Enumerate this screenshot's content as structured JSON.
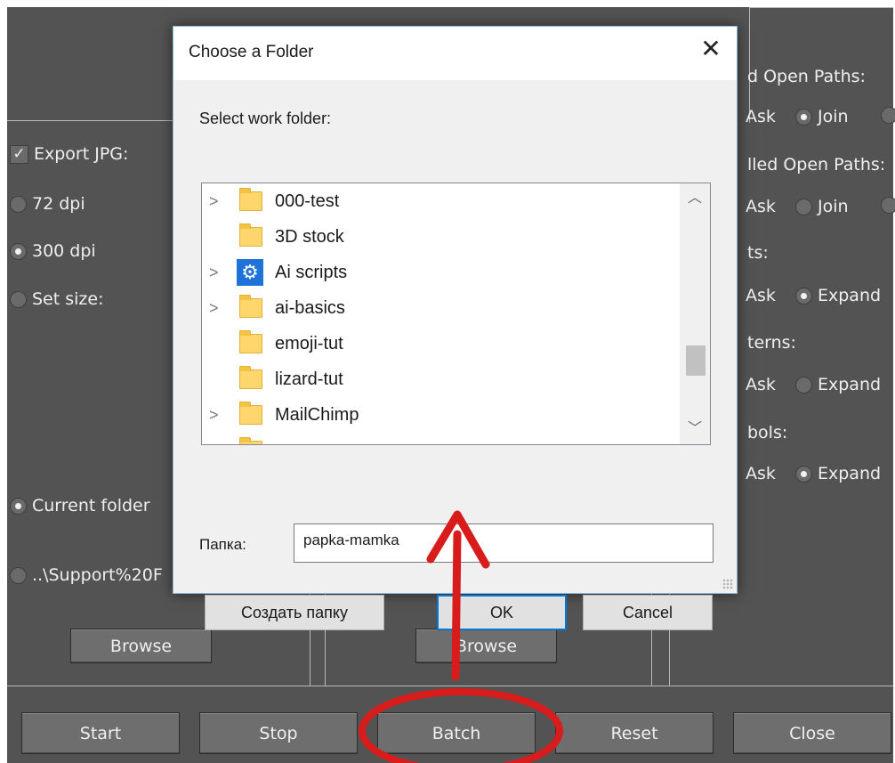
{
  "background": {
    "left": {
      "export_jpg": "Export JPG:",
      "dpi72": "72 dpi",
      "dpi300": "300 dpi",
      "set_size": "Set size:",
      "current_folder": "Current folder",
      "support_path": "..\\Support%20F",
      "browse": "Browse"
    },
    "middle": {
      "browse": "Browse"
    },
    "right": {
      "open_paths": "d Open Paths:",
      "filled_open_paths": "lled Open Paths:",
      "ts": "ts:",
      "terns": "terns:",
      "bols": "bols:",
      "ask": "Ask",
      "join": "Join",
      "expand": "Expand"
    },
    "bottom": {
      "start": "Start",
      "stop": "Stop",
      "batch": "Batch",
      "reset": "Reset",
      "close": "Close"
    }
  },
  "dialog": {
    "title": "Choose a Folder",
    "close_glyph": "✕",
    "prompt": "Select work folder:",
    "tree": [
      {
        "label": "000-test",
        "expandable": true,
        "icon": "folder-icon"
      },
      {
        "label": "3D stock",
        "expandable": false,
        "icon": "folder-icon"
      },
      {
        "label": "Ai scripts",
        "expandable": true,
        "icon": "gear-icon"
      },
      {
        "label": "ai-basics",
        "expandable": true,
        "icon": "folder-icon"
      },
      {
        "label": "emoji-tut",
        "expandable": false,
        "icon": "folder-icon"
      },
      {
        "label": "lizard-tut",
        "expandable": false,
        "icon": "folder-icon"
      },
      {
        "label": "MailChimp",
        "expandable": true,
        "icon": "folder-icon"
      }
    ],
    "folder_label": "Папка:",
    "folder_value": "papka-mamka",
    "create_folder": "Создать папку",
    "ok": "OK",
    "cancel": "Cancel"
  },
  "annotation_color": "#d81b1b"
}
